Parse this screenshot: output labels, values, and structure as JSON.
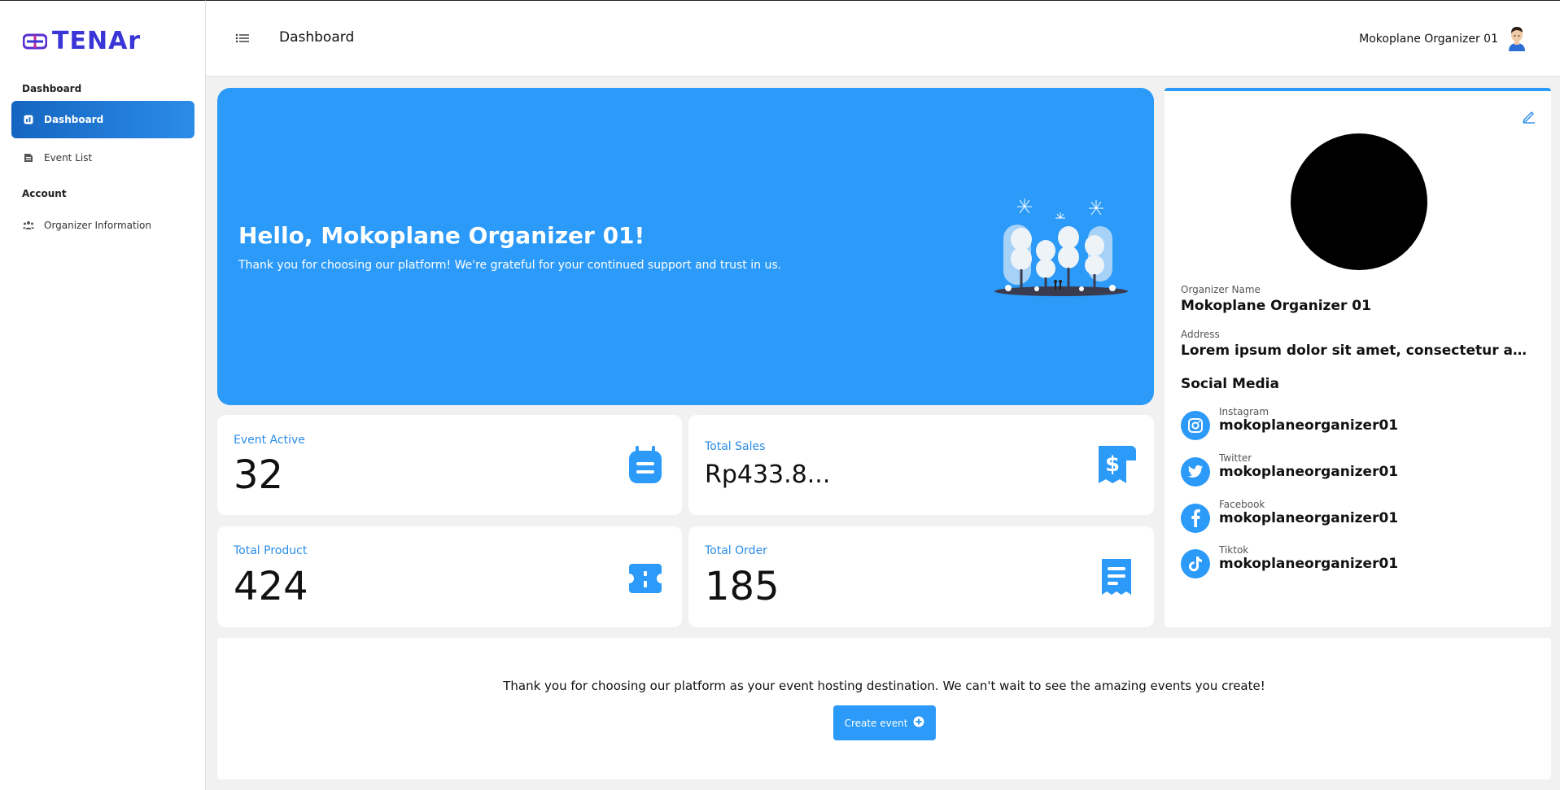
{
  "brand": {
    "name": "TENAr"
  },
  "sidebar": {
    "sections": [
      "Dashboard",
      "Account"
    ],
    "items": [
      {
        "label": "Dashboard",
        "icon": "dashboard-icon",
        "active": true
      },
      {
        "label": "Event List",
        "icon": "list-icon",
        "active": false
      },
      {
        "label": "Organizer Information",
        "icon": "users-icon",
        "active": false
      }
    ]
  },
  "header": {
    "title": "Dashboard",
    "user_name": "Mokoplane Organizer 01"
  },
  "hero": {
    "greeting": "Hello, Mokoplane Organizer 01!",
    "message": "Thank you for choosing our platform! We're grateful for your continued support and trust in us."
  },
  "stats": [
    {
      "label": "Event Active",
      "value": "32",
      "icon": "calendar-icon"
    },
    {
      "label": "Total Sales",
      "value": "Rp433.8...",
      "icon": "sales-receipt-icon"
    },
    {
      "label": "Total Product",
      "value": "424",
      "icon": "ticket-icon"
    },
    {
      "label": "Total Order",
      "value": "185",
      "icon": "order-receipt-icon"
    }
  ],
  "profile": {
    "name_label": "Organizer Name",
    "name": "Mokoplane Organizer 01",
    "address_label": "Address",
    "address": "Lorem ipsum dolor sit amet, consectetur adipiscin...",
    "social_title": "Social Media",
    "socials": [
      {
        "platform": "Instagram",
        "handle": "mokoplaneorganizer01",
        "icon": "instagram-icon"
      },
      {
        "platform": "Twitter",
        "handle": "mokoplaneorganizer01",
        "icon": "twitter-icon"
      },
      {
        "platform": "Facebook",
        "handle": "mokoplaneorganizer01",
        "icon": "facebook-icon"
      },
      {
        "platform": "Tiktok",
        "handle": "mokoplaneorganizer01",
        "icon": "tiktok-icon"
      }
    ]
  },
  "footer": {
    "message": "Thank you for choosing our platform as your event hosting destination. We can't wait to see the amazing events you create!",
    "button_label": "Create event"
  },
  "colors": {
    "accent": "#2b9af8",
    "active_nav": "#1565c0",
    "background": "#f1f1f1"
  }
}
